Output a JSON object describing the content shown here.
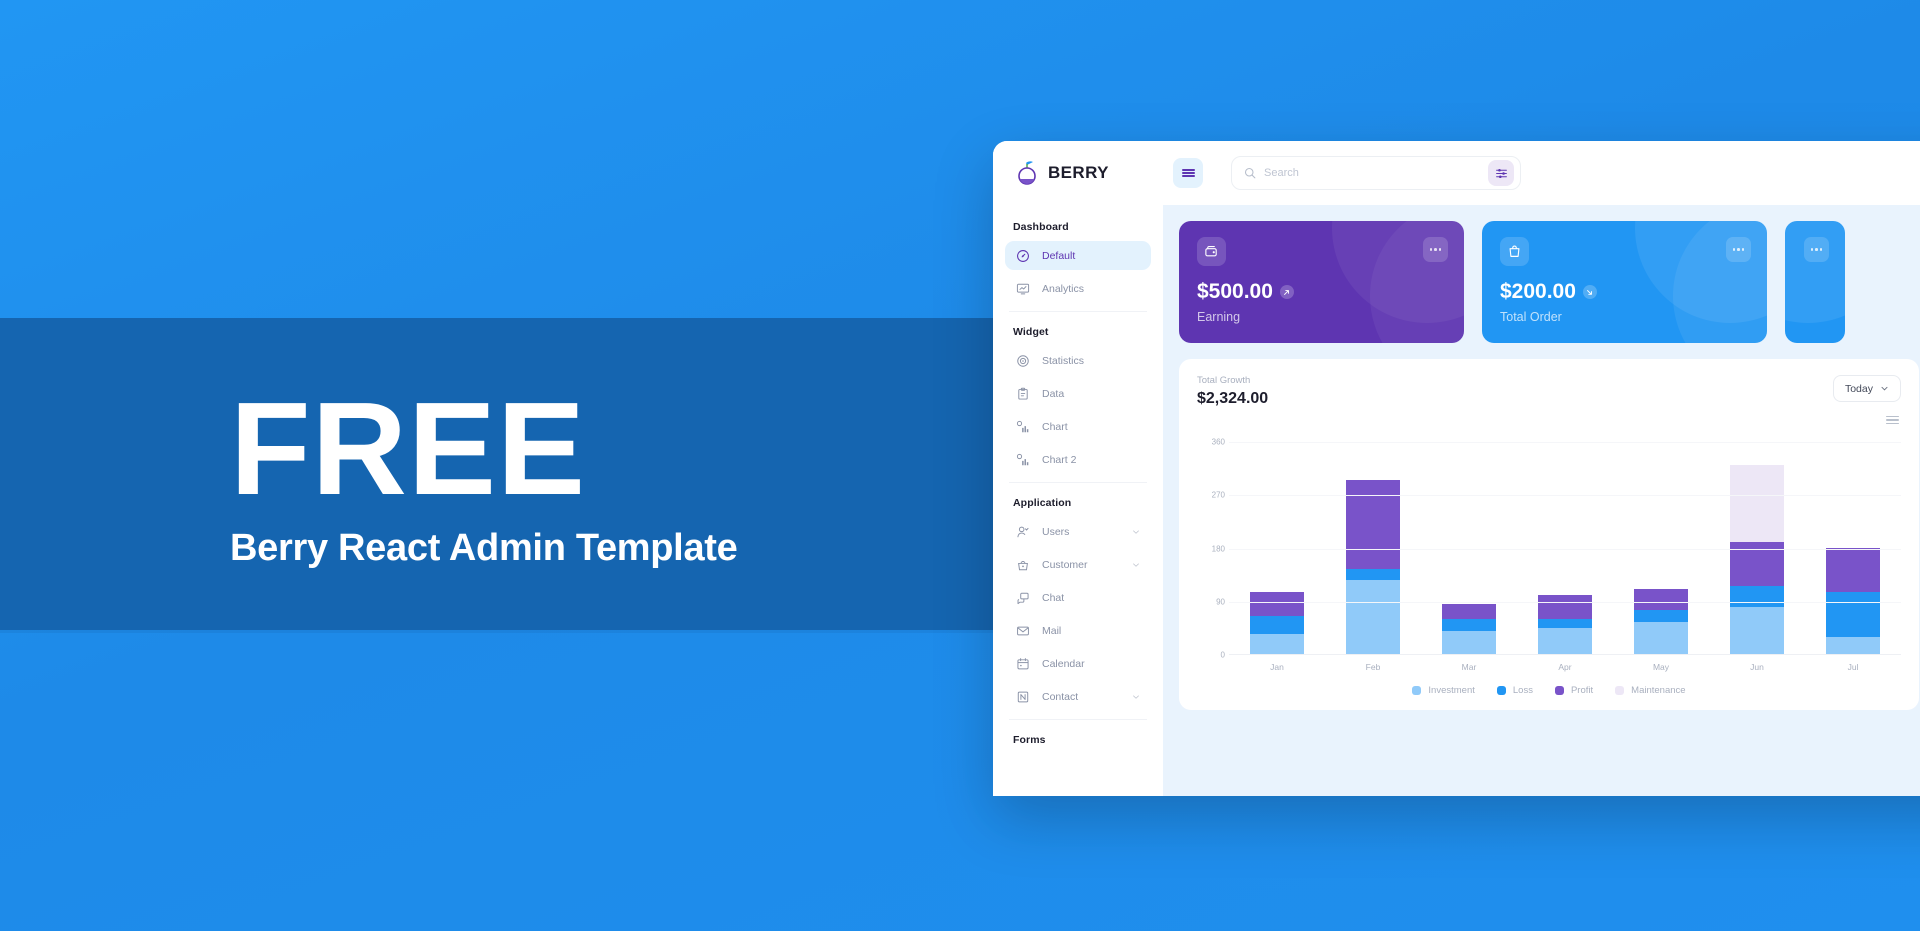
{
  "hero": {
    "title": "FREE",
    "subtitle": "Berry React Admin Template"
  },
  "app": {
    "brand": "BERRY",
    "search": {
      "placeholder": "Search"
    }
  },
  "sidebar": {
    "sections": [
      {
        "header": "Dashboard",
        "items": [
          {
            "label": "Default",
            "icon": "speedometer-icon",
            "active": true,
            "chevron": false
          },
          {
            "label": "Analytics",
            "icon": "monitor-chart-icon",
            "active": false,
            "chevron": false
          }
        ]
      },
      {
        "header": "Widget",
        "items": [
          {
            "label": "Statistics",
            "icon": "target-icon",
            "active": false,
            "chevron": false
          },
          {
            "label": "Data",
            "icon": "clipboard-icon",
            "active": false,
            "chevron": false
          },
          {
            "label": "Chart",
            "icon": "bar-chart-icon",
            "active": false,
            "chevron": false
          },
          {
            "label": "Chart 2",
            "icon": "bar-chart-icon",
            "active": false,
            "chevron": false
          }
        ]
      },
      {
        "header": "Application",
        "items": [
          {
            "label": "Users",
            "icon": "user-icon",
            "active": false,
            "chevron": true
          },
          {
            "label": "Customer",
            "icon": "basket-icon",
            "active": false,
            "chevron": true
          },
          {
            "label": "Chat",
            "icon": "chat-icon",
            "active": false,
            "chevron": false
          },
          {
            "label": "Mail",
            "icon": "mail-icon",
            "active": false,
            "chevron": false
          },
          {
            "label": "Calendar",
            "icon": "calendar-icon",
            "active": false,
            "chevron": false
          },
          {
            "label": "Contact",
            "icon": "contact-icon",
            "active": false,
            "chevron": true
          }
        ]
      },
      {
        "header": "Forms",
        "items": []
      }
    ]
  },
  "cards": [
    {
      "amount": "$500.00",
      "label": "Earning",
      "icon": "wallet-icon",
      "trend": "up",
      "color": "#5e35b1",
      "style": "purple"
    },
    {
      "amount": "$200.00",
      "label": "Total Order",
      "icon": "shopping-bag-icon",
      "trend": "down",
      "color": "#2196f3",
      "style": "blue"
    }
  ],
  "growth_panel": {
    "title": "Total Growth",
    "amount": "$2,324.00",
    "range_label": "Today"
  },
  "chart_data": {
    "type": "bar",
    "title": "Total Growth",
    "stacked": true,
    "categories": [
      "Jan",
      "Feb",
      "Mar",
      "Apr",
      "May",
      "Jun",
      "Jul"
    ],
    "series": [
      {
        "name": "Investment",
        "color": "#90caf9",
        "values": [
          35,
          125,
          40,
          45,
          55,
          80,
          30
        ]
      },
      {
        "name": "Loss",
        "color": "#2196f3",
        "values": [
          30,
          20,
          20,
          15,
          20,
          35,
          75
        ]
      },
      {
        "name": "Profit",
        "color": "#7953c9",
        "values": [
          40,
          150,
          25,
          40,
          35,
          75,
          75
        ]
      },
      {
        "name": "Maintenance",
        "color": "#ede7f6",
        "values": [
          0,
          0,
          0,
          0,
          0,
          130,
          0
        ]
      }
    ],
    "yticks": [
      0,
      90,
      180,
      270,
      360
    ],
    "ylim": [
      0,
      380
    ],
    "xlabel": "",
    "ylabel": "",
    "grid": true,
    "legend_position": "bottom"
  }
}
